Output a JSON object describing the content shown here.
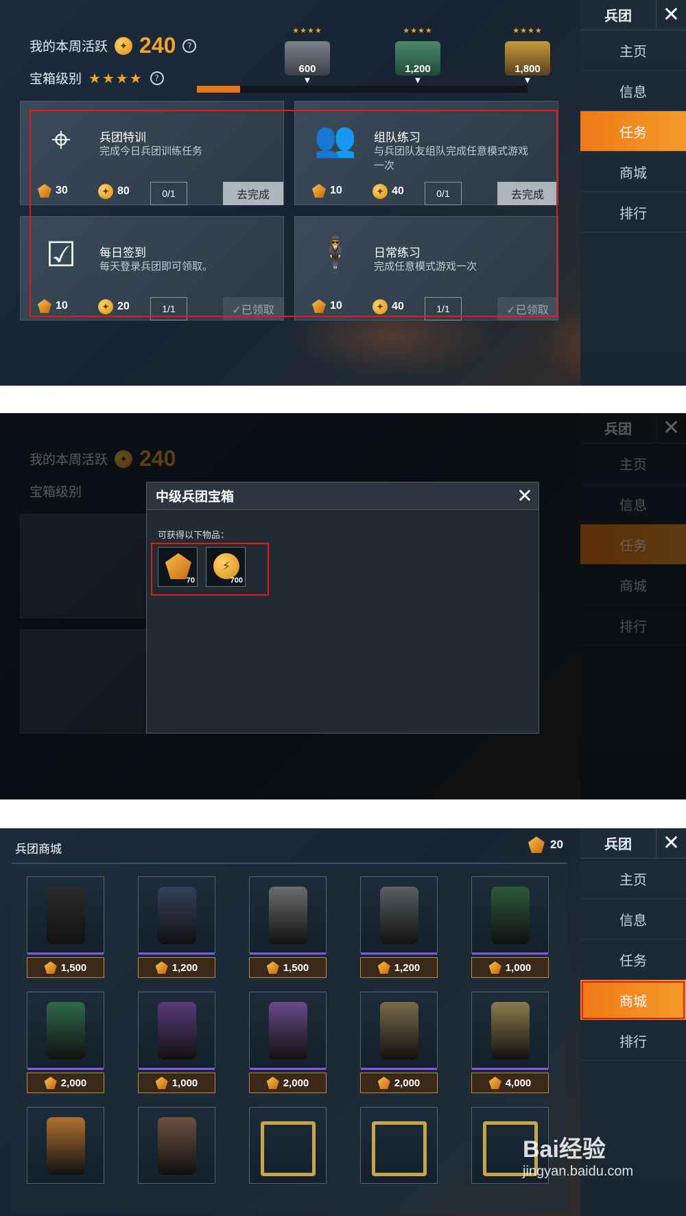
{
  "sidebar": {
    "title": "兵团",
    "items": [
      "主页",
      "信息",
      "任务",
      "商城",
      "排行"
    ]
  },
  "activity": {
    "weekly_label": "我的本周活跃",
    "weekly_value": "240",
    "chest_level_label": "宝箱级别",
    "chest_level_stars": "★★★★",
    "milestones": [
      {
        "stars": "★★★★",
        "value": "600"
      },
      {
        "stars": "★★★★",
        "value": "1,200"
      },
      {
        "stars": "★★★★",
        "value": "1,800"
      }
    ],
    "progress": 0.13
  },
  "tasks": [
    {
      "title": "兵团特训",
      "desc": "完成今日兵团训练任务",
      "gem": "30",
      "coin": "80",
      "count": "0/1",
      "action": "去完成",
      "icon": "crosshair-icon"
    },
    {
      "title": "组队练习",
      "desc": "与兵团队友组队完成任意模式游戏一次",
      "gem": "10",
      "coin": "40",
      "count": "0/1",
      "action": "去完成",
      "icon": "team-icon"
    },
    {
      "title": "每日签到",
      "desc": "每天登录兵团即可领取。",
      "gem": "10",
      "coin": "20",
      "count": "1/1",
      "action": "✓已领取",
      "icon": "calendar-check-icon"
    },
    {
      "title": "日常练习",
      "desc": "完成任意模式游戏一次",
      "gem": "10",
      "coin": "40",
      "count": "1/1",
      "action": "✓已领取",
      "icon": "soldier-icon"
    }
  ],
  "modal": {
    "title": "中级兵团宝箱",
    "subtitle": "可获得以下物品：",
    "items": [
      {
        "icon": "gem-icon",
        "count": "70"
      },
      {
        "icon": "coin-icon",
        "count": "700"
      }
    ]
  },
  "shop": {
    "title": "兵团商城",
    "balance": "20",
    "items": [
      {
        "icon": "black-jacket-icon",
        "price": "1,500"
      },
      {
        "icon": "black-pants-icon",
        "price": "1,200"
      },
      {
        "icon": "grey-jacket-icon",
        "price": "1,500"
      },
      {
        "icon": "grey-pants-icon",
        "price": "1,200"
      },
      {
        "icon": "green-coat-icon",
        "price": "1,000"
      },
      {
        "icon": "green-pants-icon",
        "price": "2,000"
      },
      {
        "icon": "purple-jacket-icon",
        "price": "1,000"
      },
      {
        "icon": "purple-pants-icon",
        "price": "2,000"
      },
      {
        "icon": "camo-pants-icon",
        "price": "2,000"
      },
      {
        "icon": "camo-jacket-icon",
        "price": "4,000"
      },
      {
        "icon": "cap-icon",
        "price": ""
      },
      {
        "icon": "mask-icon",
        "price": ""
      },
      {
        "icon": "frame-silver-icon",
        "price": ""
      },
      {
        "icon": "frame-gold-icon",
        "price": ""
      },
      {
        "icon": "frame-winged-icon",
        "price": ""
      }
    ]
  },
  "watermark": {
    "line1": "Bai经验",
    "line2": "jingyan.baidu.com"
  },
  "colors": {
    "accent": "#f07a18",
    "gold": "#f0a52a",
    "highlight": "#e01c1c"
  }
}
